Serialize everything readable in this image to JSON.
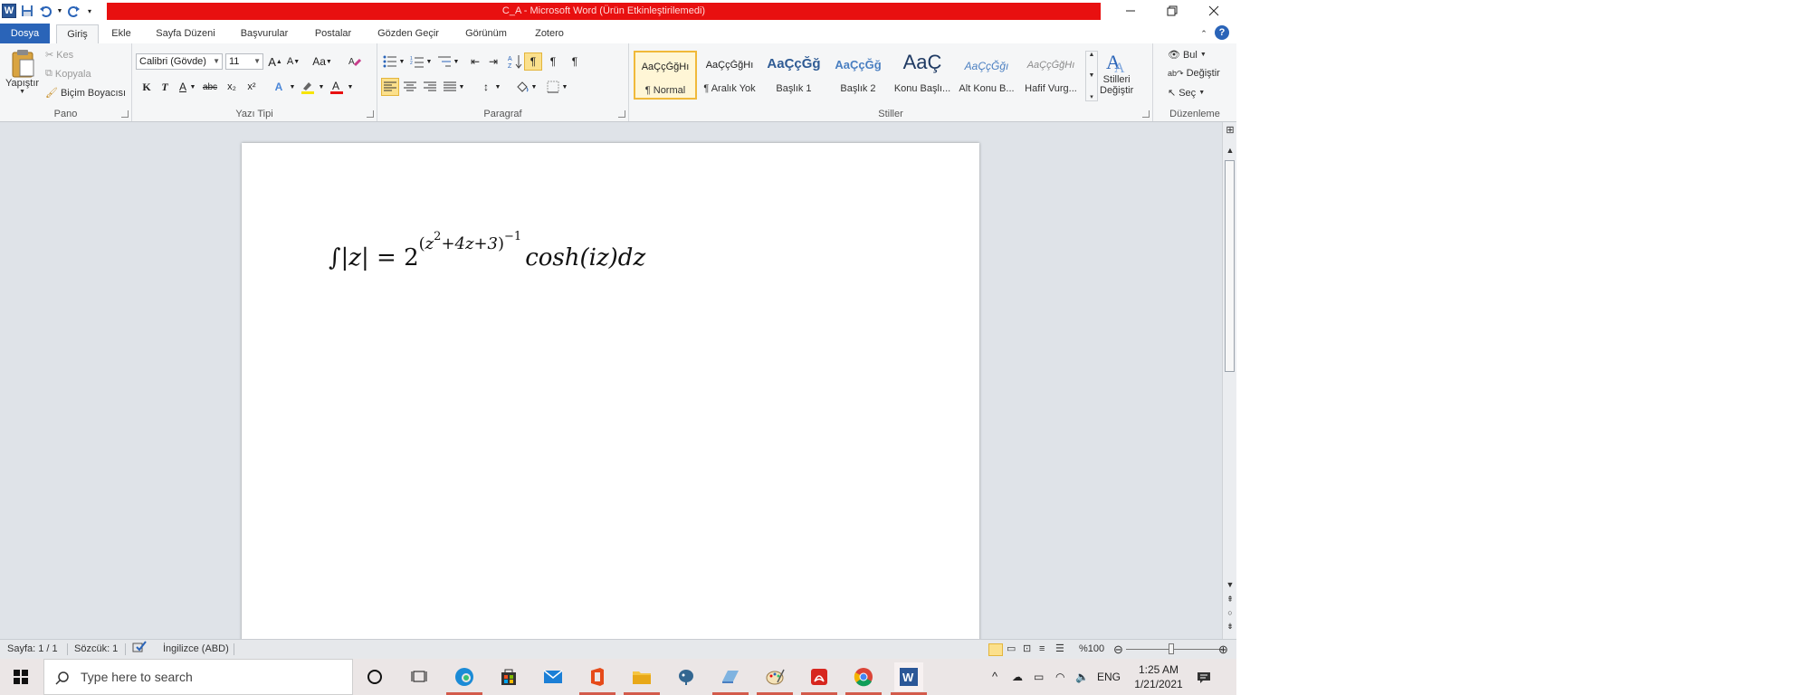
{
  "window": {
    "title": "C_A  -  Microsoft Word (Ürün Etkinleştirilemedi)"
  },
  "qat": {
    "logo": "W"
  },
  "tabs": [
    {
      "label": "Dosya"
    },
    {
      "label": "Giriş"
    },
    {
      "label": "Ekle"
    },
    {
      "label": "Sayfa Düzeni"
    },
    {
      "label": "Başvurular"
    },
    {
      "label": "Postalar"
    },
    {
      "label": "Gözden Geçir"
    },
    {
      "label": "Görünüm"
    },
    {
      "label": "Zotero"
    }
  ],
  "ribbon": {
    "clipboard": {
      "label": "Pano",
      "paste": "Yapıştır",
      "cut": "Kes",
      "copy": "Kopyala",
      "format_painter": "Biçim Boyacısı"
    },
    "font": {
      "label": "Yazı Tipi",
      "font_name": "Calibri (Gövde)",
      "font_size": "11",
      "bold": "K",
      "italic": "T",
      "underline": "A",
      "strike": "abc",
      "subscript": "x₂",
      "superscript": "x²",
      "change_case": "Aa"
    },
    "paragraph": {
      "label": "Paragraf",
      "pilcrow": "¶"
    },
    "styles": {
      "label": "Stiller",
      "items": [
        {
          "sample": "AaÇçĞğHı",
          "name": "¶ Normal"
        },
        {
          "sample": "AaÇçĞğHı",
          "name": "¶ Aralık Yok"
        },
        {
          "sample": "AaÇçĞğ",
          "name": "Başlık 1"
        },
        {
          "sample": "AaÇçĞğ",
          "name": "Başlık 2"
        },
        {
          "sample": "AaÇ",
          "name": "Konu Başlı..."
        },
        {
          "sample": "AaÇçĞğı",
          "name": "Alt Konu B..."
        },
        {
          "sample": "AaÇçĞğHı",
          "name": "Hafif Vurg..."
        }
      ],
      "change_styles_line1": "Stilleri",
      "change_styles_line2": "Değiştir"
    },
    "editing": {
      "label": "Düzenleme",
      "find": "Bul",
      "replace": "Değiştir",
      "select": "Seç"
    }
  },
  "document": {
    "eq_integral": "∫",
    "eq_abs": "|z|",
    "eq_equals": " = ",
    "eq_base": "2",
    "eq_open": "(",
    "eq_z": "z",
    "eq_z_exp": "2",
    "eq_rest": "+4z+3",
    "eq_close": ")",
    "eq_outer_exp": "−1",
    "eq_tail": "cosh(iz)dz"
  },
  "status": {
    "page": "Sayfa: 1 / 1",
    "words": "Sözcük: 1",
    "language": "İngilizce (ABD)",
    "zoom": "%100",
    "zoom_level_percent": 100
  },
  "taskbar": {
    "search_placeholder": "Type here to search",
    "lang": "ENG",
    "time": "1:25 AM",
    "date": "1/21/2021"
  },
  "colors": {
    "title_band": "#e81010",
    "file_tab": "#2a64b8",
    "accent_highlight": "#fbe08c"
  }
}
